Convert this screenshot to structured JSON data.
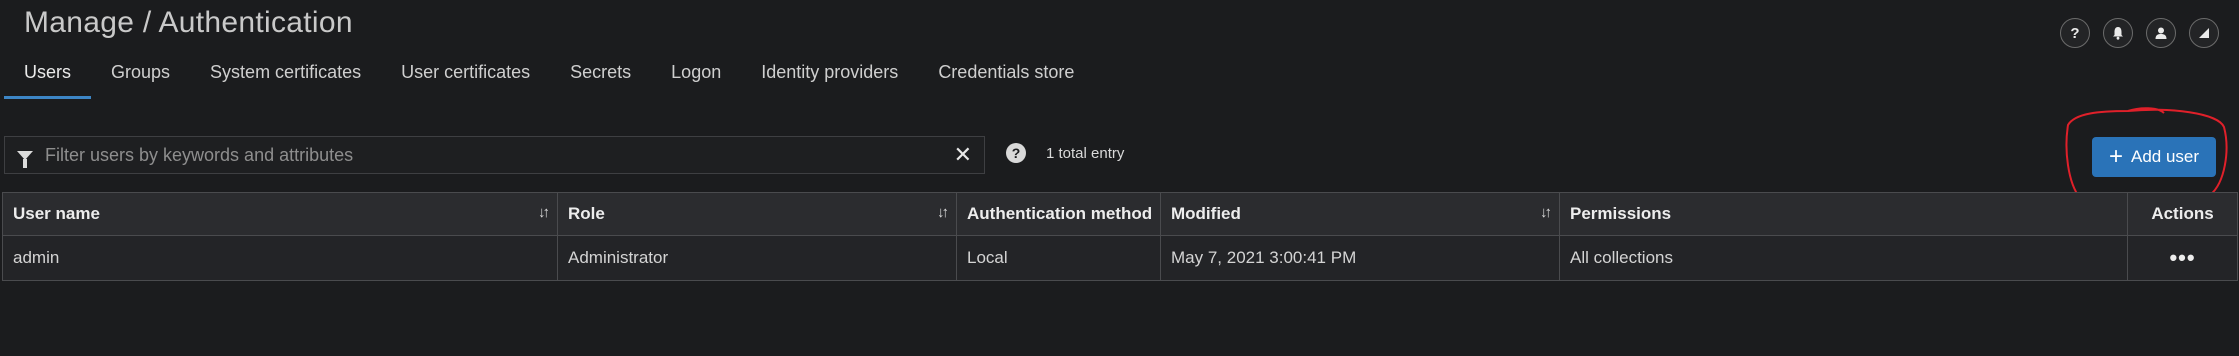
{
  "header": {
    "title": "Manage / Authentication",
    "icons": [
      "help-icon",
      "bell-icon",
      "user-icon",
      "signal-icon"
    ]
  },
  "tabs": [
    {
      "label": "Users",
      "active": true
    },
    {
      "label": "Groups"
    },
    {
      "label": "System certificates"
    },
    {
      "label": "User certificates"
    },
    {
      "label": "Secrets"
    },
    {
      "label": "Logon"
    },
    {
      "label": "Identity providers"
    },
    {
      "label": "Credentials store"
    }
  ],
  "filter": {
    "placeholder": "Filter users by keywords and attributes",
    "value": ""
  },
  "entry_count": "1 total entry",
  "add_user_label": "Add user",
  "table": {
    "columns": [
      "User name",
      "Role",
      "Authentication method",
      "Modified",
      "Permissions",
      "Actions"
    ],
    "rows": [
      [
        "admin",
        "Administrator",
        "Local",
        "May 7, 2021 3:00:41 PM",
        "All collections"
      ]
    ]
  },
  "colors": {
    "accent": "#2a73b8",
    "tab_underline": "#3d86c6",
    "annotation": "#e0202a",
    "background": "#1b1c1e"
  }
}
